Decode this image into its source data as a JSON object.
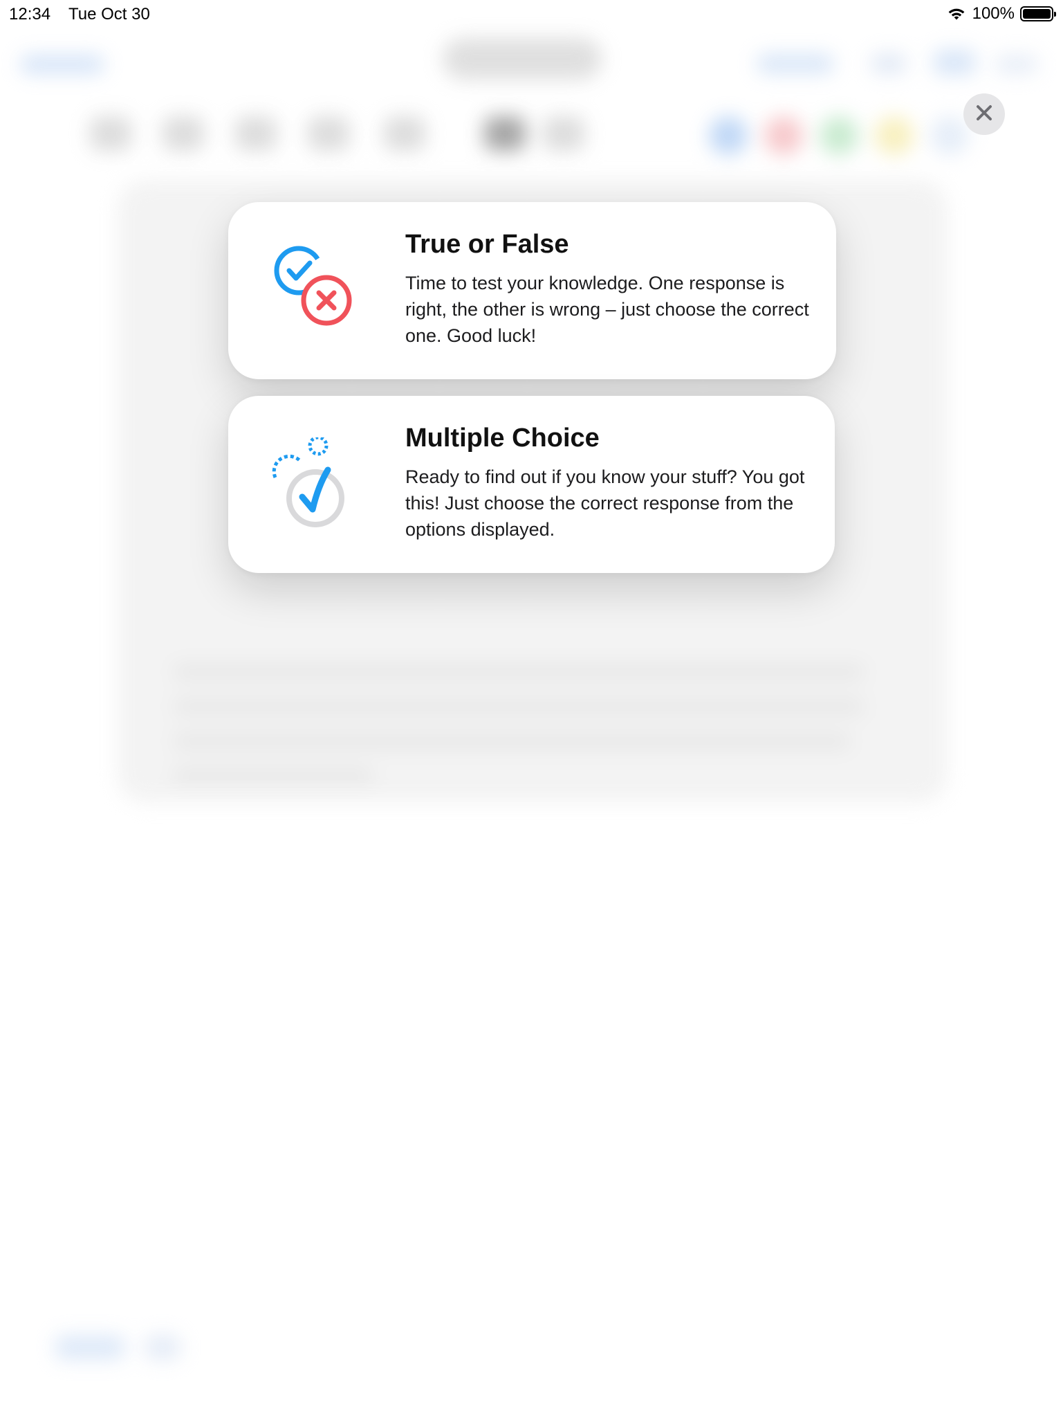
{
  "status_bar": {
    "time": "12:34",
    "date": "Tue Oct 30",
    "battery_percent": "100%",
    "battery_level": 1.0,
    "icons": [
      "wifi-icon",
      "battery-icon"
    ]
  },
  "close_button": {
    "icon": "close-icon"
  },
  "options": [
    {
      "title": "True or False",
      "description": "Time to test your knowledge. One response is right, the other is wrong – just choose the correct one. Good luck!",
      "icon": "true-false-icon"
    },
    {
      "title": "Multiple Choice",
      "description": "Ready to find out if you know your stuff? You got this! Just choose the correct response from the options displayed.",
      "icon": "multiple-choice-icon"
    }
  ],
  "colors": {
    "accent_blue": "#1E9BF0",
    "error_red": "#F0525A",
    "neutral_gray": "#D9D9DB",
    "close_button_bg": "#E6E6E8",
    "card_bg": "#FFFFFF"
  }
}
